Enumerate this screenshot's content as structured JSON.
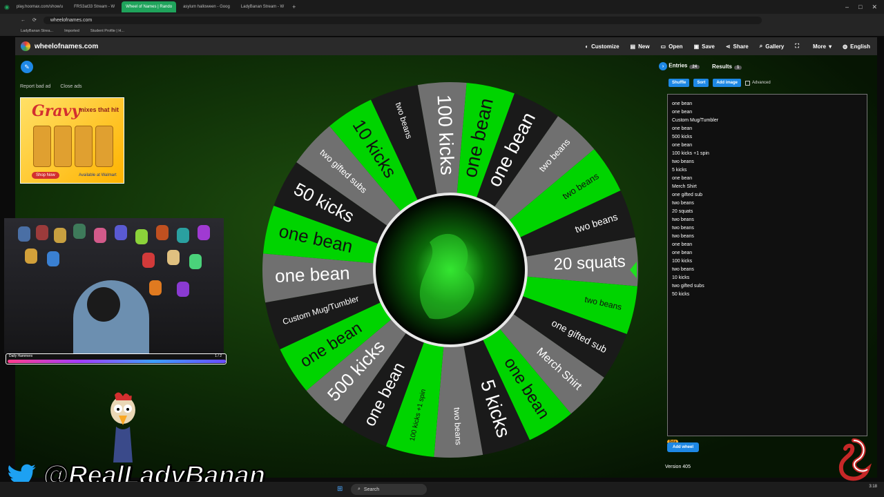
{
  "browser": {
    "tabs": [
      {
        "label": "play.hoomax.com/show/u",
        "active": false
      },
      {
        "label": "FRS3at33 Stream - W",
        "active": false
      },
      {
        "label": "Wheel of Names | Rando",
        "active": true
      },
      {
        "label": "asylum halloween - Goog",
        "active": false
      },
      {
        "label": "LadyBanan Stream - W",
        "active": false
      }
    ],
    "url": "wheelofnames.com",
    "bookmarks": [
      "LadyBanan Strea...",
      "Imported",
      "Student Profile | H..."
    ]
  },
  "navbar": {
    "site": "wheelofnames.com",
    "menu": [
      {
        "label": "Customize",
        "icon": "palette-icon"
      },
      {
        "label": "New",
        "icon": "file-icon"
      },
      {
        "label": "Open",
        "icon": "folder-icon"
      },
      {
        "label": "Save",
        "icon": "save-icon"
      },
      {
        "label": "Share",
        "icon": "share-icon"
      },
      {
        "label": "Gallery",
        "icon": "search-icon"
      },
      {
        "label": "",
        "icon": "fullscreen-icon"
      },
      {
        "label": "More",
        "icon": "chevron-down-icon"
      },
      {
        "label": "English",
        "icon": "globe-icon"
      }
    ]
  },
  "ad": {
    "report": "Report bad ad",
    "close": "Close ads",
    "headline": "Gravy",
    "tagline": "mixes that hit",
    "cta": "Shop Now",
    "retailer": "Available at Walmart"
  },
  "stream": {
    "bar_left": "Daily Hammers",
    "bar_right": "1 / 2",
    "handle": "@RealLadyBanan"
  },
  "wheel": {
    "segments": [
      {
        "label": "20 squats",
        "color": "#707070",
        "size": 24
      },
      {
        "label": "two beans",
        "color": "#00d400",
        "size": 12
      },
      {
        "label": "one gifted sub",
        "color": "#1a1a1a",
        "size": 14
      },
      {
        "label": "Merch Shirt",
        "color": "#707070",
        "size": 16
      },
      {
        "label": "one bean",
        "color": "#00d400",
        "size": 24
      },
      {
        "label": "5 kicks",
        "color": "#1a1a1a",
        "size": 28
      },
      {
        "label": "two beans",
        "color": "#707070",
        "size": 12
      },
      {
        "label": "100 kicks +1 spin",
        "color": "#00d400",
        "size": 10
      },
      {
        "label": "one bean",
        "color": "#1a1a1a",
        "size": 24
      },
      {
        "label": "500 kicks",
        "color": "#707070",
        "size": 26
      },
      {
        "label": "one bean",
        "color": "#00d400",
        "size": 24
      },
      {
        "label": "Custom Mug/Tumbler",
        "color": "#1a1a1a",
        "size": 12
      },
      {
        "label": "one bean",
        "color": "#707070",
        "size": 26
      },
      {
        "label": "one bean",
        "color": "#00d400",
        "size": 26
      },
      {
        "label": "50 kicks",
        "color": "#1a1a1a",
        "size": 26
      },
      {
        "label": "two gifted subs",
        "color": "#707070",
        "size": 13
      },
      {
        "label": "10 kicks",
        "color": "#00d400",
        "size": 26
      },
      {
        "label": "two beans",
        "color": "#1a1a1a",
        "size": 12
      },
      {
        "label": "100 kicks",
        "color": "#707070",
        "size": 28
      },
      {
        "label": "one bean",
        "color": "#00d400",
        "size": 28
      },
      {
        "label": "one bean",
        "color": "#1a1a1a",
        "size": 28
      },
      {
        "label": "two beans",
        "color": "#707070",
        "size": 13
      },
      {
        "label": "two beans",
        "color": "#00d400",
        "size": 13
      },
      {
        "label": "two beans",
        "color": "#1a1a1a",
        "size": 14
      }
    ]
  },
  "panel": {
    "tab_entries": "Entries",
    "entries_count": "24",
    "tab_results": "Results",
    "results_count": "1",
    "buttons": {
      "shuffle": "Shuffle",
      "sort": "Sort",
      "add_image": "Add image",
      "advanced": "Advanced"
    },
    "entries": [
      "one bean",
      "one bean",
      "Custom Mug/Tumbler",
      "one bean",
      "500 kicks",
      "one bean",
      "100 kicks +1 spin",
      "two beans",
      "5 kicks",
      "one bean",
      "Merch Shirt",
      "one gifted sub",
      "two beans",
      "20 squats",
      "two beans",
      "two beans",
      "two beans",
      "one bean",
      "one bean",
      "100 kicks",
      "two beans",
      "10 kicks",
      "two gifted subs",
      "50 kicks"
    ],
    "beta": "Beta",
    "add_wheel": "Add wheel",
    "version": "Version 405"
  },
  "taskbar": {
    "search": "Search",
    "time": "3:18"
  }
}
